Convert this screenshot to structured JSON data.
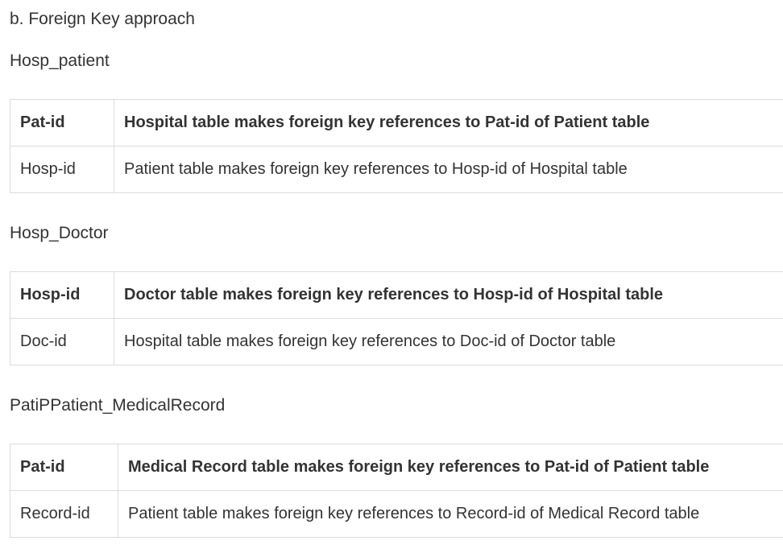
{
  "section_title": "b. Foreign Key approach",
  "tables": [
    {
      "heading": "Hosp_patient",
      "rows": [
        {
          "key": "Pat-id",
          "description": "Hospital table makes foreign key references to Pat-id of Patient table"
        },
        {
          "key": "Hosp-id",
          "description": "Patient table makes foreign key references to Hosp-id of Hospital table"
        }
      ]
    },
    {
      "heading": "Hosp_Doctor",
      "rows": [
        {
          "key": "Hosp-id",
          "description": "Doctor table makes foreign key references to Hosp-id of Hospital table"
        },
        {
          "key": "Doc-id",
          "description": "Hospital table makes foreign key references to Doc-id of Doctor table"
        }
      ]
    },
    {
      "heading": "PatiPPatient_MedicalRecord",
      "rows": [
        {
          "key": "Pat-id",
          "description": "Medical Record table makes foreign key references to Pat-id of Patient table"
        },
        {
          "key": "Record-id",
          "description": "Patient table makes foreign key references to Record-id of Medical Record table"
        }
      ]
    }
  ]
}
